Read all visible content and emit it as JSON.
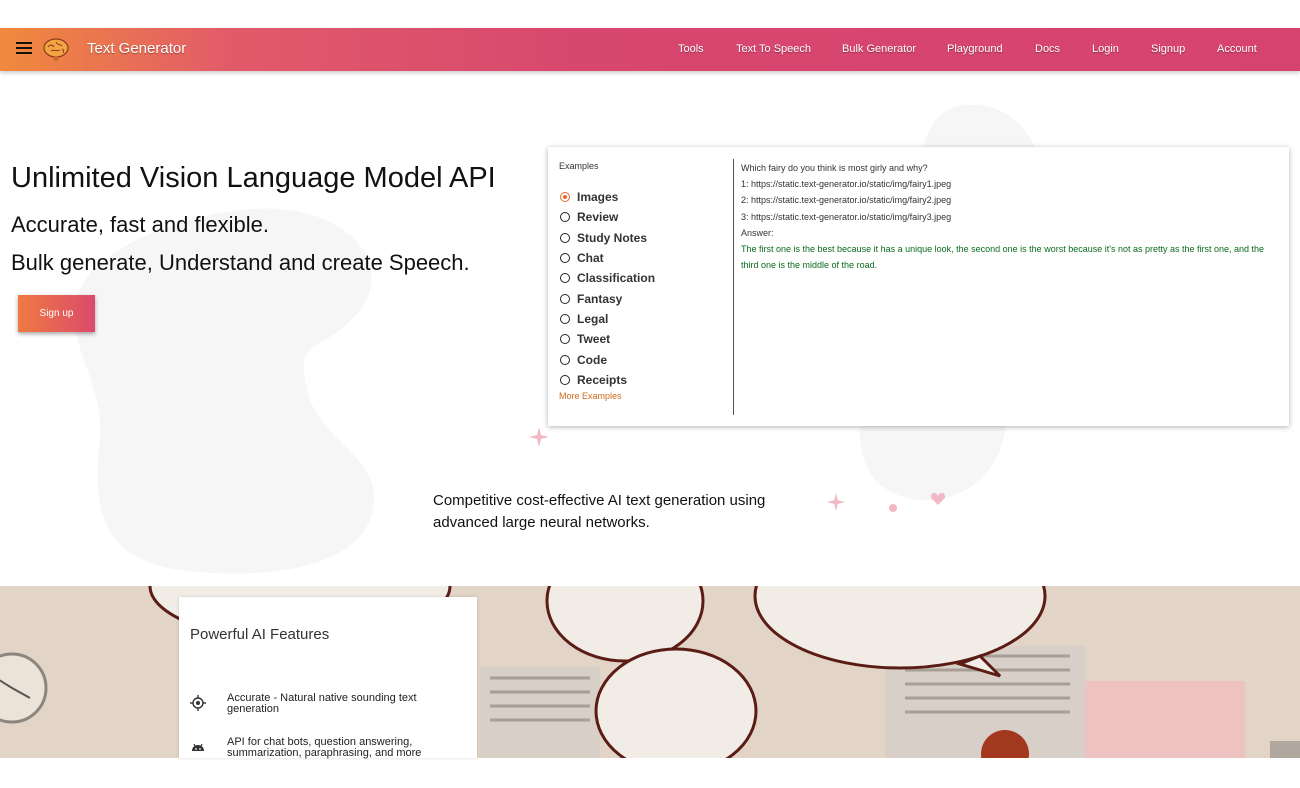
{
  "nav": {
    "brand": "Text Generator",
    "links": [
      "Tools",
      "Text To Speech",
      "Bulk Generator",
      "Playground",
      "Docs",
      "Login",
      "Signup",
      "Account"
    ]
  },
  "hero": {
    "title": "Unlimited Vision Language Model API",
    "subtitle_1": "Accurate, fast and flexible.",
    "subtitle_2": "Bulk generate, Understand and create Speech.",
    "signup_label": "Sign up"
  },
  "examples": {
    "label": "Examples",
    "options": [
      "Images",
      "Review",
      "Study Notes",
      "Chat",
      "Classification",
      "Fantasy",
      "Legal",
      "Tweet",
      "Code",
      "Receipts"
    ],
    "selected": "Images",
    "more_label": "More Examples",
    "prompt_lines": [
      "Which fairy do you think is most girly and why?",
      "1: https://static.text-generator.io/static/img/fairy1.jpeg",
      "2: https://static.text-generator.io/static/img/fairy2.jpeg",
      "3: https://static.text-generator.io/static/img/fairy3.jpeg",
      "Answer:"
    ],
    "answer": "The first one is the best because it has a unique look, the second one is the worst because it's not as pretty as the first one, and the third one is the middle of the road."
  },
  "tagline": "Competitive cost-effective AI text generation using advanced large neural networks.",
  "features": {
    "title": "Powerful AI Features",
    "items": [
      {
        "icon": "crosshair-icon",
        "text": "Accurate - Natural native sounding text generation"
      },
      {
        "icon": "android-icon",
        "text": "API for chat bots, question answering, summarization, paraphrasing, and more"
      }
    ]
  },
  "colors": {
    "accent": "#e8692e",
    "nav_start": "#f08a3c",
    "nav_end": "#d6436f",
    "answer_text": "#0b6b1e",
    "link_orange": "#d2691e"
  }
}
